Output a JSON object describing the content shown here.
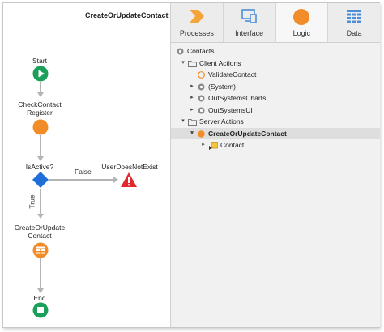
{
  "flow": {
    "title": "CreateOrUpdateContact",
    "start_label": "Start",
    "check_label_1": "CheckContact",
    "check_label_2": "Register",
    "if_label": "IsActive?",
    "false_label": "False",
    "true_label": "True",
    "error_label": "UserDoesNotExist",
    "action_label_1": "CreateOrUpdate",
    "action_label_2": "Contact",
    "end_label": "End"
  },
  "tabs": [
    {
      "label": "Processes",
      "icon": "processes-chevron-icon"
    },
    {
      "label": "Interface",
      "icon": "interface-screen-icon"
    },
    {
      "label": "Logic",
      "icon": "logic-circle-icon",
      "active": true
    },
    {
      "label": "Data",
      "icon": "data-table-icon"
    }
  ],
  "tree": {
    "root": "Contacts",
    "client_actions": "Client Actions",
    "client_items": [
      "ValidateContact",
      "(System)",
      "OutSystemsCharts",
      "OutSystemsUI"
    ],
    "server_actions": "Server Actions",
    "selected_action": "CreateOrUpdateContact",
    "child": "Contact"
  },
  "colors": {
    "accent_orange": "#f28c28",
    "start_green": "#1aa05a",
    "if_blue": "#1e6fd9",
    "error_red": "#e0282e",
    "tab_icon_orange": "#f5a43a",
    "tab_icon_blue": "#4c8fd8"
  }
}
